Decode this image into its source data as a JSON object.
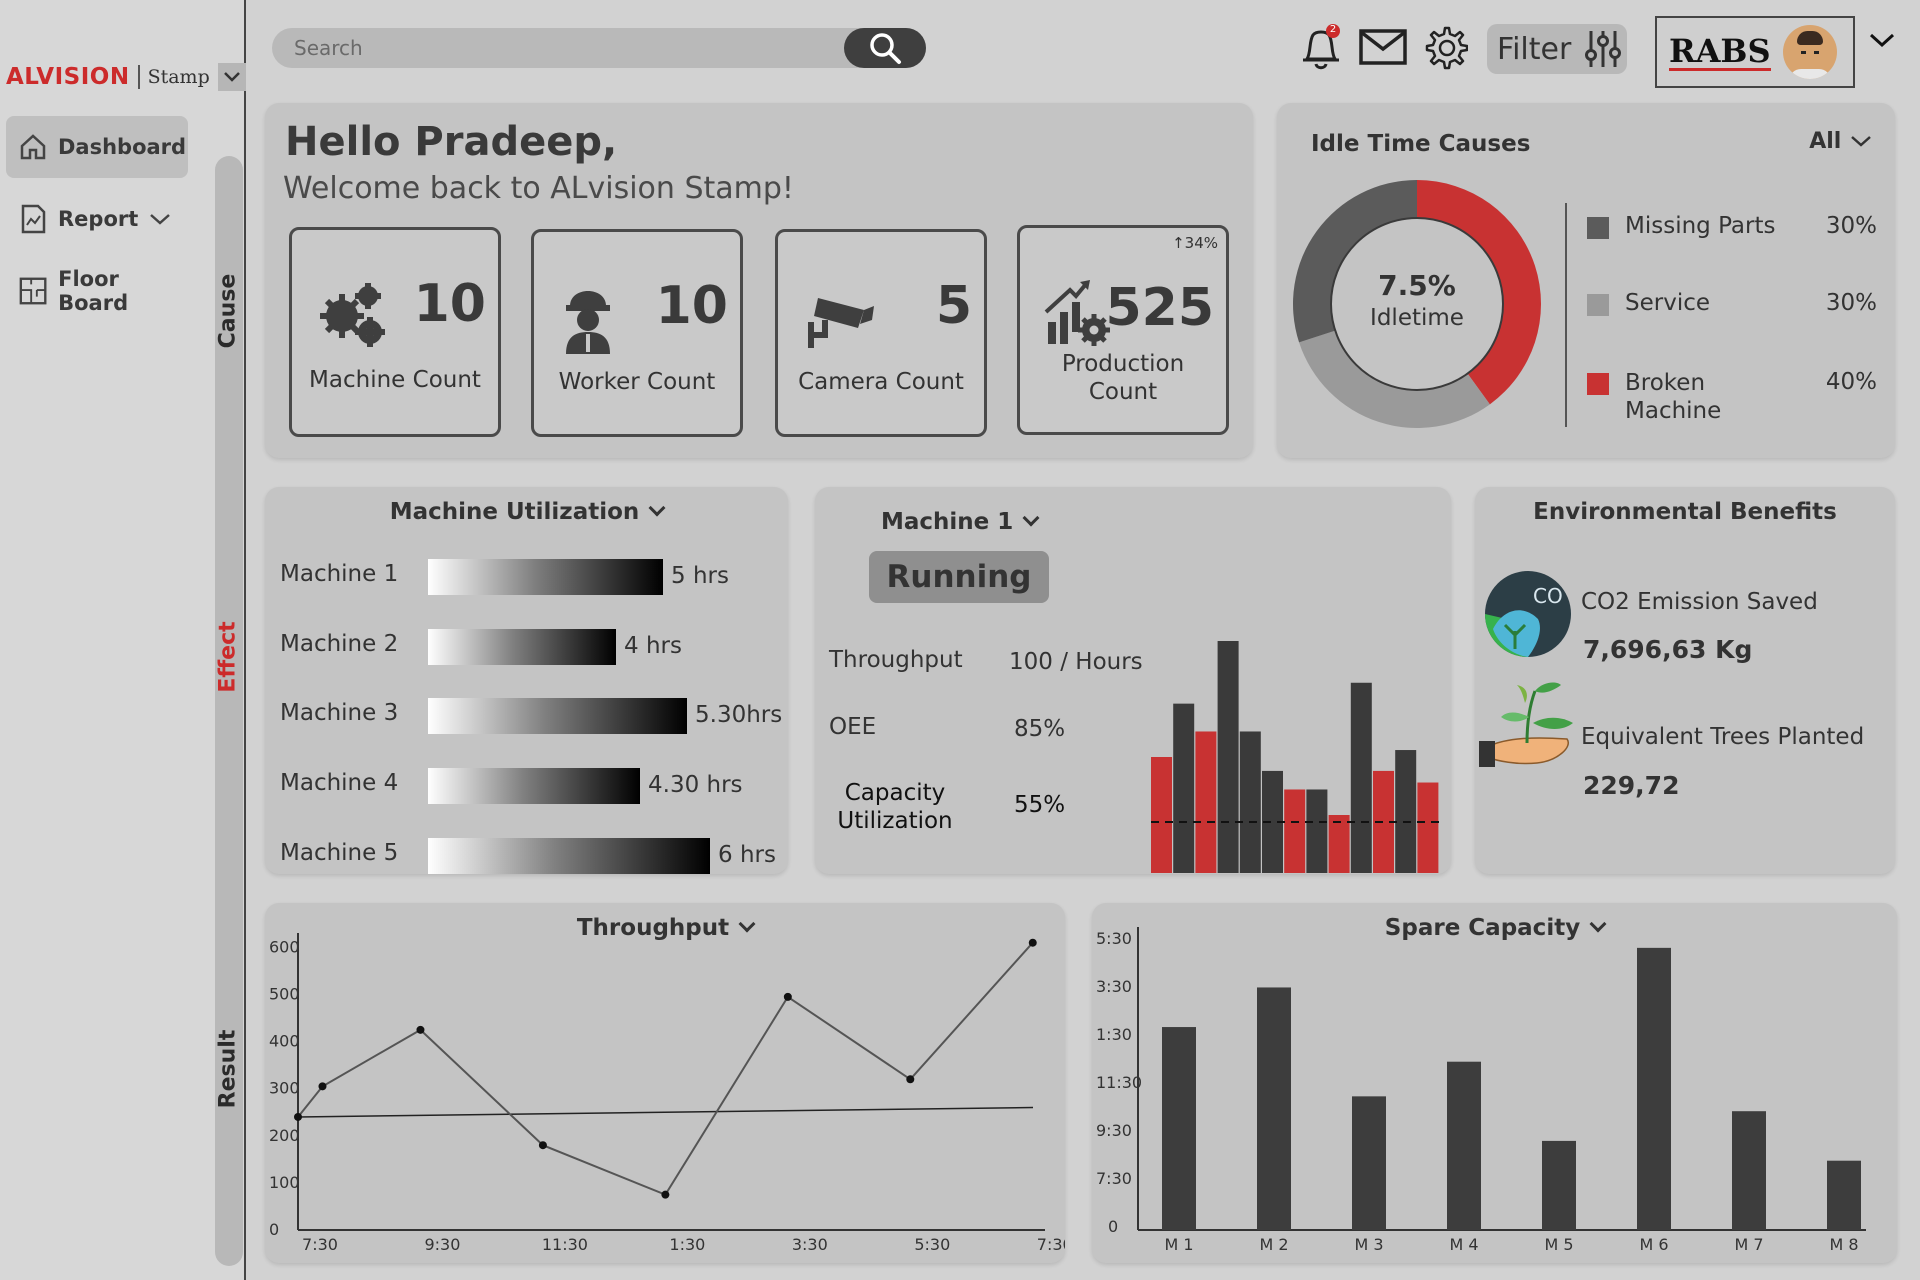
{
  "sidebar": {
    "logo_brand": "ALVISION",
    "logo_product": "Stamp",
    "items": [
      {
        "label": "Dashboard",
        "icon": "home-icon",
        "active": true
      },
      {
        "label": "Report",
        "icon": "report-icon",
        "active": false
      },
      {
        "label": "Floor Board",
        "icon": "floor-plan-icon",
        "active": false
      }
    ],
    "rail_labels": {
      "cause": "Cause",
      "effect": "Effect",
      "result": "Result"
    }
  },
  "topbar": {
    "search_placeholder": "Search",
    "notification_count": "2",
    "filter_label": "Filter",
    "company_logo": "RABS"
  },
  "welcome": {
    "greeting": "Hello Pradeep,",
    "subtitle": "Welcome back to ALvision Stamp!"
  },
  "stats": [
    {
      "value": "10",
      "label": "Machine Count",
      "icon": "gears-icon"
    },
    {
      "value": "10",
      "label": "Worker Count",
      "icon": "worker-icon"
    },
    {
      "value": "5",
      "label": "Camera Count",
      "icon": "camera-icon"
    },
    {
      "value": "525",
      "label": "Production Count",
      "icon": "production-icon",
      "trend": "34%"
    }
  ],
  "idle": {
    "title": "Idle Time Causes",
    "dropdown": "All",
    "center_value": "7.5%",
    "center_label": "Idletime",
    "causes": [
      {
        "label": "Missing Parts",
        "value": "30%",
        "percent": 30,
        "color": "#5b5b5b"
      },
      {
        "label": "Service",
        "value": "30%",
        "percent": 30,
        "color": "#9a9a9a"
      },
      {
        "label": "Broken Machine",
        "value": "40%",
        "percent": 40,
        "color": "#c83232"
      }
    ]
  },
  "utilization": {
    "title": "Machine Utilization",
    "rows": [
      {
        "name": "Machine 1",
        "value": "5 hrs",
        "hours": 5
      },
      {
        "name": "Machine 2",
        "value": "4 hrs",
        "hours": 4
      },
      {
        "name": "Machine 3",
        "value": "5.30hrs",
        "hours": 5.5
      },
      {
        "name": "Machine 4",
        "value": "4.30 hrs",
        "hours": 4.5
      },
      {
        "name": "Machine 5",
        "value": "6 hrs",
        "hours": 6
      }
    ]
  },
  "machine": {
    "title": "Machine 1",
    "status": "Running",
    "metrics": [
      {
        "label": "Throughput",
        "value": "100 / Hours"
      },
      {
        "label": "OEE",
        "value": "85%"
      },
      {
        "label": "Capacity Utilization",
        "value": "55%"
      }
    ],
    "mini_bars": [
      {
        "value": 50,
        "color": "#c83232"
      },
      {
        "value": 73,
        "color": "#3a3a3a"
      },
      {
        "value": 61,
        "color": "#c83232"
      },
      {
        "value": 100,
        "color": "#3a3a3a"
      },
      {
        "value": 61,
        "color": "#3a3a3a"
      },
      {
        "value": 44,
        "color": "#3a3a3a"
      },
      {
        "value": 36,
        "color": "#c83232"
      },
      {
        "value": 36,
        "color": "#3a3a3a"
      },
      {
        "value": 25,
        "color": "#c83232"
      },
      {
        "value": 82,
        "color": "#3a3a3a"
      },
      {
        "value": 44,
        "color": "#c83232"
      },
      {
        "value": 53,
        "color": "#3a3a3a"
      },
      {
        "value": 39,
        "color": "#c83232"
      }
    ],
    "threshold": 22
  },
  "environment": {
    "title": "Environmental Benefits",
    "items": [
      {
        "label": "CO2 Emission Saved",
        "value": "7,696,63 Kg",
        "icon": "co2-icon"
      },
      {
        "label": "Equivalent Trees Planted",
        "value": "229,72",
        "icon": "plant-icon"
      }
    ]
  },
  "throughput_title": "Throughput",
  "spare_title": "Spare Capacity",
  "chart_data": [
    {
      "type": "line",
      "title": "Throughput",
      "x_ticks": [
        "7:30",
        "9:30",
        "11:30",
        "1:30",
        "3:30",
        "5:30",
        "7:30"
      ],
      "y_ticks": [
        0,
        100,
        200,
        300,
        400,
        500,
        600
      ],
      "ylim": [
        0,
        620
      ],
      "points": [
        {
          "x": 0,
          "y": 240
        },
        {
          "x": 0.2,
          "y": 305
        },
        {
          "x": 1.0,
          "y": 425
        },
        {
          "x": 2.0,
          "y": 180
        },
        {
          "x": 3.0,
          "y": 75
        },
        {
          "x": 4.0,
          "y": 495
        },
        {
          "x": 5.0,
          "y": 320
        },
        {
          "x": 6.0,
          "y": 610
        }
      ],
      "reference_line": {
        "y_start": 240,
        "y_end": 260
      }
    },
    {
      "type": "bar",
      "title": "Spare Capacity",
      "categories": [
        "M 1",
        "M 2",
        "M 3",
        "M 4",
        "M 5",
        "M 6",
        "M 7",
        "M 8"
      ],
      "y_ticks": [
        "0",
        "7:30",
        "9:30",
        "11:30",
        "1:30",
        "3:30",
        "5:30"
      ],
      "values": [
        4.1,
        4.9,
        2.7,
        3.4,
        1.8,
        5.7,
        2.4,
        1.4
      ],
      "ylim": [
        0,
        6
      ]
    }
  ]
}
